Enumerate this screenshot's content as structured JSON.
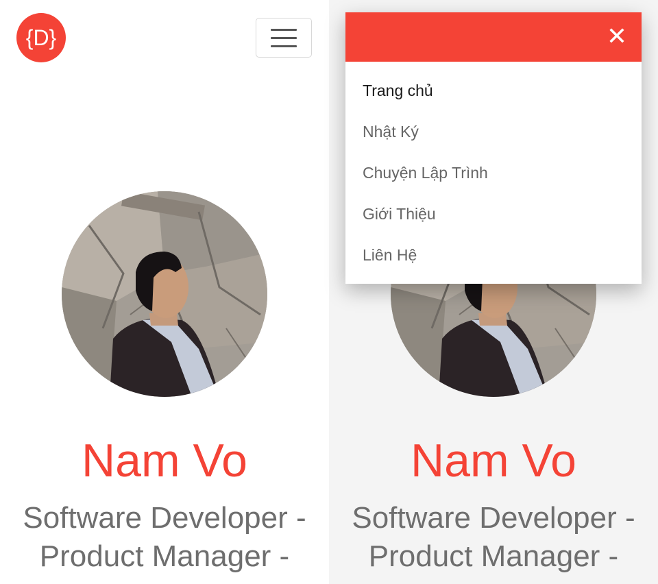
{
  "header": {
    "logo_text": "{D}",
    "menu_toggle_icon": "hamburger-icon"
  },
  "profile": {
    "name": "Nam Vo",
    "role": "Software Developer - Product Manager -",
    "avatar": "profile-photo"
  },
  "nav_menu": {
    "close_icon": "close-icon",
    "close_glyph": "✕",
    "items": [
      {
        "label": "Trang chủ",
        "active": true
      },
      {
        "label": "Nhật Ký"
      },
      {
        "label": "Chuyện Lập Trình"
      },
      {
        "label": "Giới Thiệu"
      },
      {
        "label": "Liên Hệ"
      }
    ]
  },
  "colors": {
    "accent": "#f44336",
    "text_muted": "#6e6e6e"
  }
}
